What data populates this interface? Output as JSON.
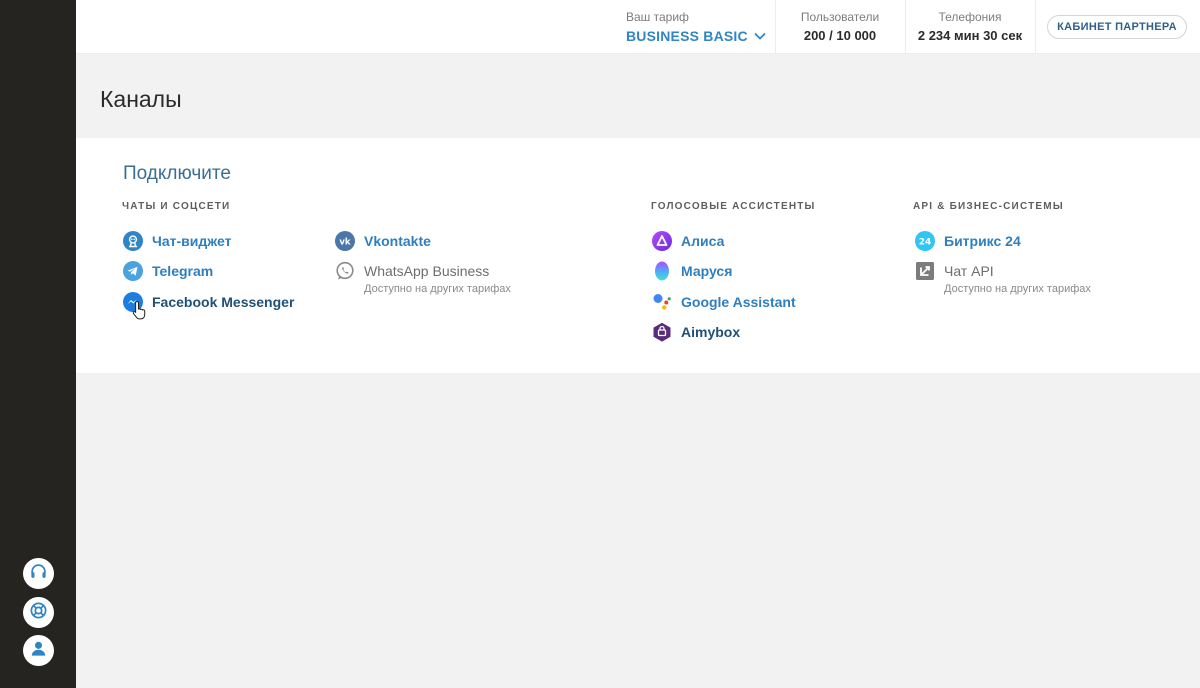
{
  "topbar": {
    "tariff_label": "Ваш тариф",
    "tariff_value": "BUSINESS BASIC",
    "users_label": "Пользователи",
    "users_value": "200 / 10 000",
    "phone_label": "Телефония",
    "phone_value": "2 234 мин 30 сек",
    "partner_button": "КАБИНЕТ ПАРТНЕРА"
  },
  "page": {
    "title": "Каналы"
  },
  "connect": {
    "title": "Подключите",
    "sections": {
      "chats": "ЧАТЫ И СОЦСЕТИ",
      "voice": "ГОЛОСОВЫЕ АССИСТЕНТЫ",
      "api": "API & БИЗНЕС-СИСТЕМЫ"
    },
    "channels": {
      "chat_widget": "Чат-виджет",
      "telegram": "Telegram",
      "facebook": "Facebook Messenger",
      "vkontakte": "Vkontakte",
      "whatsapp": "WhatsApp Business",
      "whatsapp_note": "Доступно на других тарифах",
      "alisa": "Алиса",
      "marusya": "Маруся",
      "google_assistant": "Google Assistant",
      "aimybox": "Aimybox",
      "bitrix": "Битрикс 24",
      "chat_api": "Чат API",
      "chat_api_note": "Доступно на других тарифах"
    }
  },
  "icons": {
    "sidebar": [
      "headset-icon",
      "help-lifebuoy-icon",
      "user-icon"
    ],
    "bitrix_badge": "24"
  },
  "colors": {
    "sidebar_bg": "#262421",
    "accent": "#2f86c7",
    "telegram": "#4aa3dd",
    "vk": "#4a76a8",
    "bitrix": "#2fc6f6"
  }
}
